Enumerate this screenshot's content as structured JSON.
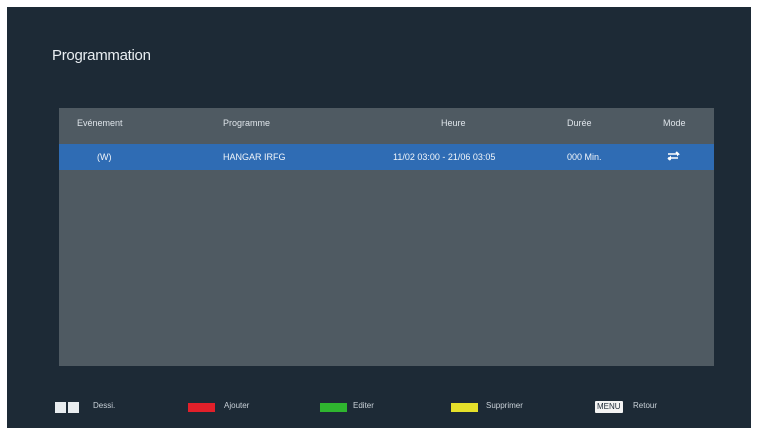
{
  "title": "Programmation",
  "table": {
    "columns": [
      "Evénement",
      "Programme",
      "Heure",
      "Durée",
      "Mode"
    ],
    "rows": [
      {
        "event": "(W)",
        "programme": "HANGAR IRFG",
        "time": "11/02 03:00 - 21/06 03:05",
        "duration": "000 Min.",
        "mode_icon": "repeat-icon"
      }
    ]
  },
  "footer": {
    "page_label": "Dessi.",
    "red_label": "Ajouter",
    "green_label": "Editer",
    "yellow_label": "Supprimer",
    "menu_key": "MENU",
    "menu_label": "Retour"
  },
  "colors": {
    "selected_row": "#2f6cb4",
    "red": "#e2202a",
    "green": "#2fb52f",
    "yellow": "#e5e02a"
  }
}
